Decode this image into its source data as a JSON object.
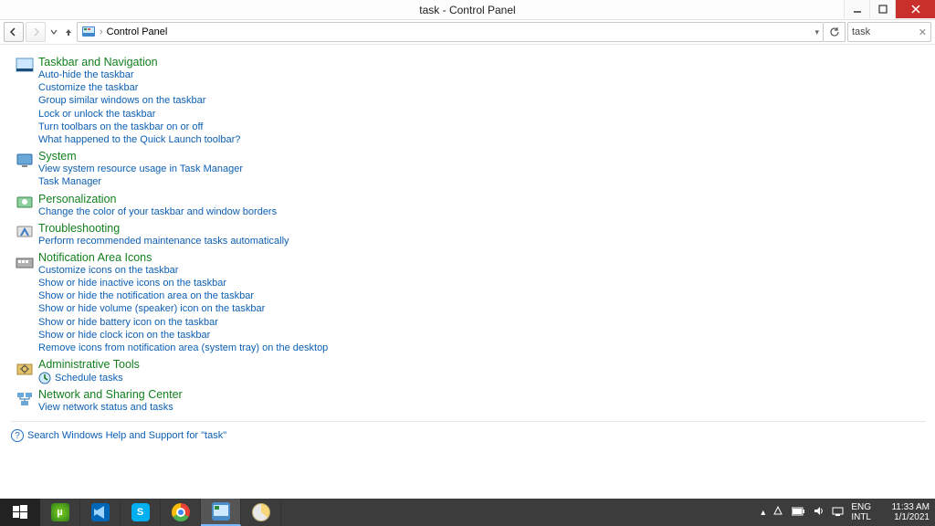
{
  "window": {
    "title": "task - Control Panel"
  },
  "address_bar": {
    "location": "Control Panel",
    "dropdown_glyph": "▾",
    "chevron_glyph": "›"
  },
  "search": {
    "value": "task",
    "clear_glyph": "✕"
  },
  "categories": [
    {
      "icon": "taskbar-nav-icon",
      "title": "Taskbar and Navigation",
      "links": [
        "Auto-hide the taskbar",
        "Customize the taskbar",
        "Group similar windows on the taskbar",
        "Lock or unlock the taskbar",
        "Turn toolbars on the taskbar on or off",
        "What happened to the Quick Launch toolbar?"
      ]
    },
    {
      "icon": "system-icon",
      "title": "System",
      "links": [
        "View system resource usage in Task Manager",
        "Task Manager"
      ]
    },
    {
      "icon": "personalization-icon",
      "title": "Personalization",
      "links": [
        "Change the color of your taskbar and window borders"
      ]
    },
    {
      "icon": "troubleshooting-icon",
      "title": "Troubleshooting",
      "links": [
        "Perform recommended maintenance tasks automatically"
      ]
    },
    {
      "icon": "notification-area-icon",
      "title": "Notification Area Icons",
      "links": [
        "Customize icons on the taskbar",
        "Show or hide inactive icons on the taskbar",
        "Show or hide the notification area on the taskbar",
        "Show or hide volume (speaker) icon on the taskbar",
        "Show or hide battery icon on the taskbar",
        "Show or hide clock icon on the taskbar",
        "Remove icons from notification area (system tray) on the desktop"
      ]
    },
    {
      "icon": "admin-tools-icon",
      "title": "Administrative Tools",
      "links_with_icon": [
        {
          "icon": "schedule-icon",
          "label": "Schedule tasks"
        }
      ]
    },
    {
      "icon": "network-sharing-icon",
      "title": "Network and Sharing Center",
      "links": [
        "View network status and tasks"
      ]
    }
  ],
  "help_search": {
    "label": "Search Windows Help and Support for \"task\""
  },
  "tray": {
    "lang1": "ENG",
    "lang2": "INTL",
    "time": "11:33 AM",
    "date": "1/1/2021",
    "up_glyph": "▴"
  }
}
